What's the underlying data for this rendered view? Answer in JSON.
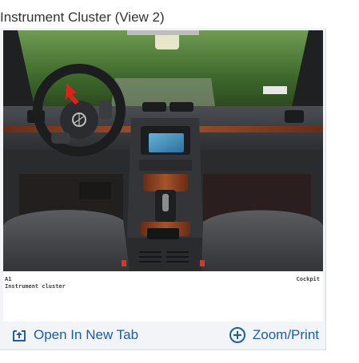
{
  "page": {
    "title": "Instrument Cluster (View 2)"
  },
  "figure": {
    "code": "A1",
    "caption": "Instrument cluster",
    "location": "Cockpit"
  },
  "actions": {
    "open_new_tab": "Open In New Tab",
    "zoom_print": "Zoom/Print"
  },
  "icons": {
    "open_new_tab": "open-in-new-tab-icon",
    "zoom_print": "zoom-plus-circle-icon",
    "pointer": "red-arrow-pointer"
  },
  "colors": {
    "link": "#1a5fa8",
    "card_bg": "#f2f4f7",
    "title": "#333333"
  }
}
